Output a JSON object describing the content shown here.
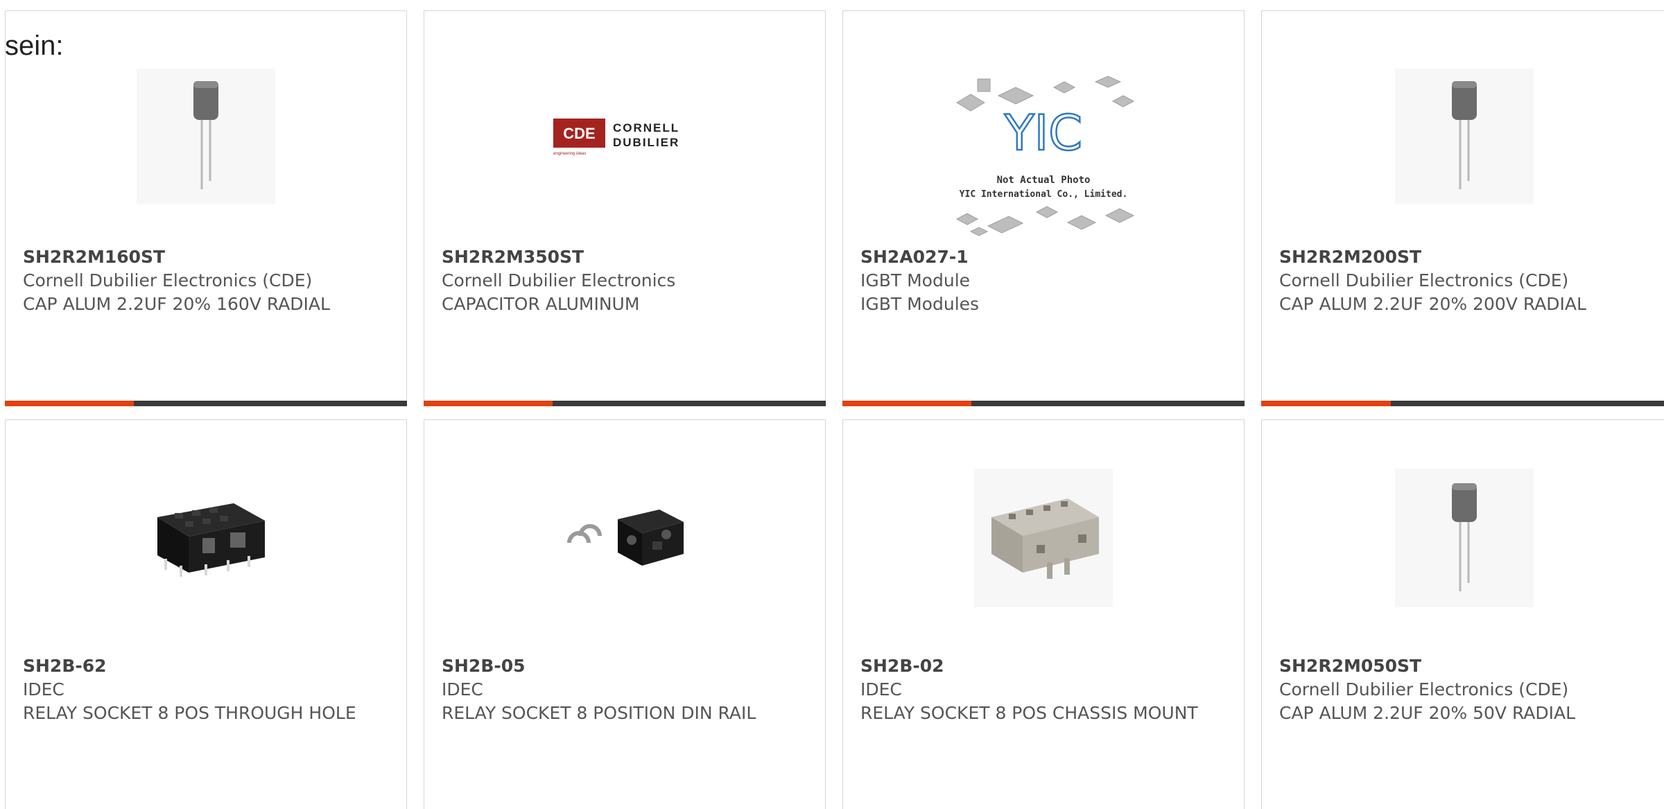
{
  "intro_text": "sein:",
  "progress_fraction": 0.32,
  "accent_color": "#e5400d",
  "track_color": "#3a3a3a",
  "products": [
    {
      "part": "SH2R2M160ST",
      "manufacturer": "Cornell Dubilier Electronics (CDE)",
      "description": "CAP ALUM 2.2UF 20% 160V RADIAL",
      "image": "capacitor-icon"
    },
    {
      "part": "SH2R2M350ST",
      "manufacturer": "Cornell Dubilier Electronics",
      "description": "CAPACITOR ALUMINUM",
      "image": "cde-logo",
      "logo_letters": "CDE",
      "logo_line1": "CORNELL",
      "logo_line2": "DUBILIER",
      "logo_tagline": "engineering ideas"
    },
    {
      "part": "SH2A027-1",
      "manufacturer": "IGBT Module",
      "description": "IGBT Modules",
      "image": "yic-placeholder",
      "logo_letters": "YIC",
      "caption1": "Not Actual Photo",
      "caption2": "YIC International Co., Limited."
    },
    {
      "part": "SH2R2M200ST",
      "manufacturer": "Cornell Dubilier Electronics (CDE)",
      "description": "CAP ALUM 2.2UF 20% 200V RADIAL",
      "image": "capacitor-icon"
    },
    {
      "part": "SH2B-62",
      "manufacturer": "IDEC",
      "description": "RELAY SOCKET 8 POS THROUGH HOLE",
      "image": "relay-socket-black-icon"
    },
    {
      "part": "SH2B-05",
      "manufacturer": "IDEC",
      "description": "RELAY SOCKET 8 POSITION DIN RAIL",
      "image": "relay-socket-din-icon"
    },
    {
      "part": "SH2B-02",
      "manufacturer": "IDEC",
      "description": "RELAY SOCKET 8 POS CHASSIS MOUNT",
      "image": "relay-socket-grey-icon"
    },
    {
      "part": "SH2R2M050ST",
      "manufacturer": "Cornell Dubilier Electronics (CDE)",
      "description": "CAP ALUM 2.2UF 20% 50V RADIAL",
      "image": "capacitor-icon"
    }
  ]
}
